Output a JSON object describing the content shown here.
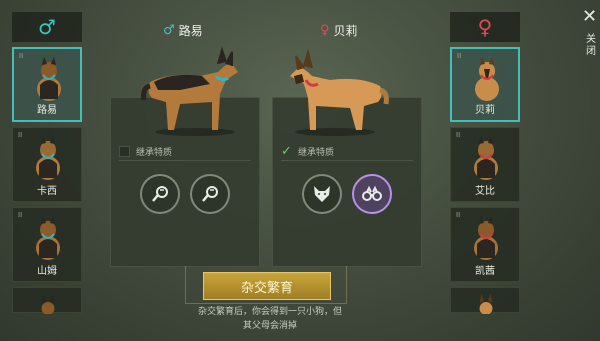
{
  "left_column": {
    "gender_symbol": "♂",
    "cards": [
      {
        "name": "路易",
        "count": "II",
        "selected": true,
        "collar": "#2fb7c8"
      },
      {
        "name": "卡西",
        "count": "II",
        "selected": false,
        "collar": "#2fb7c8"
      },
      {
        "name": "山姆",
        "count": "II",
        "selected": false,
        "collar": "#2fb7c8"
      }
    ]
  },
  "right_column": {
    "gender_symbol": "♀",
    "cards": [
      {
        "name": "贝莉",
        "count": "II",
        "selected": true,
        "collar": "#d23a48"
      },
      {
        "name": "艾比",
        "count": "II",
        "selected": false,
        "collar": "#d23a48"
      },
      {
        "name": "凯茜",
        "count": "II",
        "selected": false,
        "collar": "#d23a48"
      }
    ]
  },
  "male_header": {
    "symbol": "♂",
    "name": "路易"
  },
  "female_header": {
    "symbol": "♀",
    "name": "贝莉"
  },
  "male_panel": {
    "trait_label": "继承特质",
    "checked": false,
    "icons": [
      "whistle-icon",
      "whistle-icon"
    ]
  },
  "female_panel": {
    "trait_label": "继承特质",
    "checked": true,
    "check_mark": "✓",
    "icons": [
      "fox-icon",
      "binoculars-icon"
    ]
  },
  "breed_button": "杂交繁育",
  "hint_line1": "杂交繁育后，你会得到一只小狗，但",
  "hint_line2": "其父母会消掉",
  "close_symbol": "✕",
  "close_label": "关闭",
  "colors": {
    "male": "#41c5c3",
    "female": "#e0495b",
    "accent": "#c9a53a",
    "highlight": "#b892e6"
  }
}
